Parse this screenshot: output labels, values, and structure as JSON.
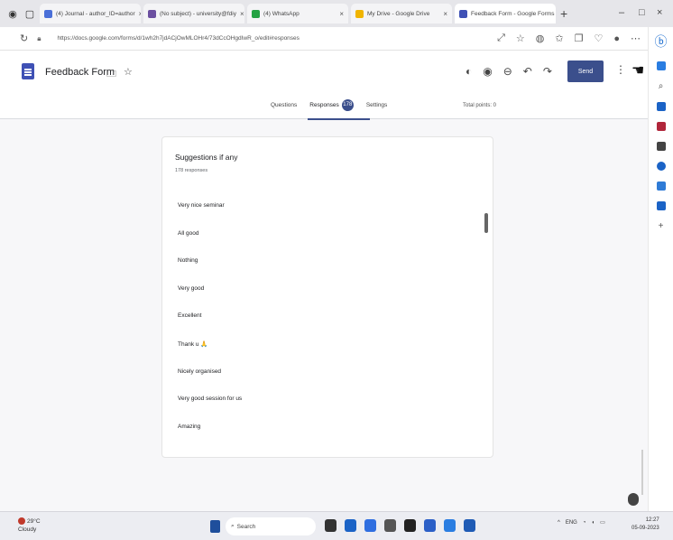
{
  "browser": {
    "tabs": [
      {
        "label": "(4) Journal - author_ID=author"
      },
      {
        "label": "(No subject) - university@fdiy"
      },
      {
        "label": "(4) WhatsApp"
      },
      {
        "label": "My Drive - Google Drive"
      },
      {
        "label": "Feedback Form - Google Forms"
      }
    ],
    "url": "https://docs.google.com/forms/d/1wh2h7jdACjOwMLOHr4/73dCcOHgdIwR_o/edit#responses",
    "new_tab_symbol": "+",
    "window_controls": [
      "–",
      "□",
      "×"
    ]
  },
  "form": {
    "title": "Feedback Form",
    "send_label": "Send",
    "tabs": [
      {
        "label": "Questions"
      },
      {
        "label": "Responses",
        "count": "178"
      },
      {
        "label": "Settings"
      }
    ],
    "total_points": "Total points: 0"
  },
  "question": {
    "title": "Suggestions if any",
    "response_count": "178 responses",
    "answers": [
      "Very nice seminar",
      "All good",
      "Nothing",
      "Very good",
      "Excellent",
      "Thank u 🙏",
      "Nicely organised",
      "Very good session for us",
      "Amazing"
    ]
  },
  "taskbar": {
    "weather_temp": "29°C",
    "weather_desc": "Cloudy",
    "search_label": "Search",
    "time": "12:27",
    "date": "05-09-2023"
  },
  "colors": {
    "accent": "#3b4f8c",
    "forms_icon": "#3f51b5"
  }
}
